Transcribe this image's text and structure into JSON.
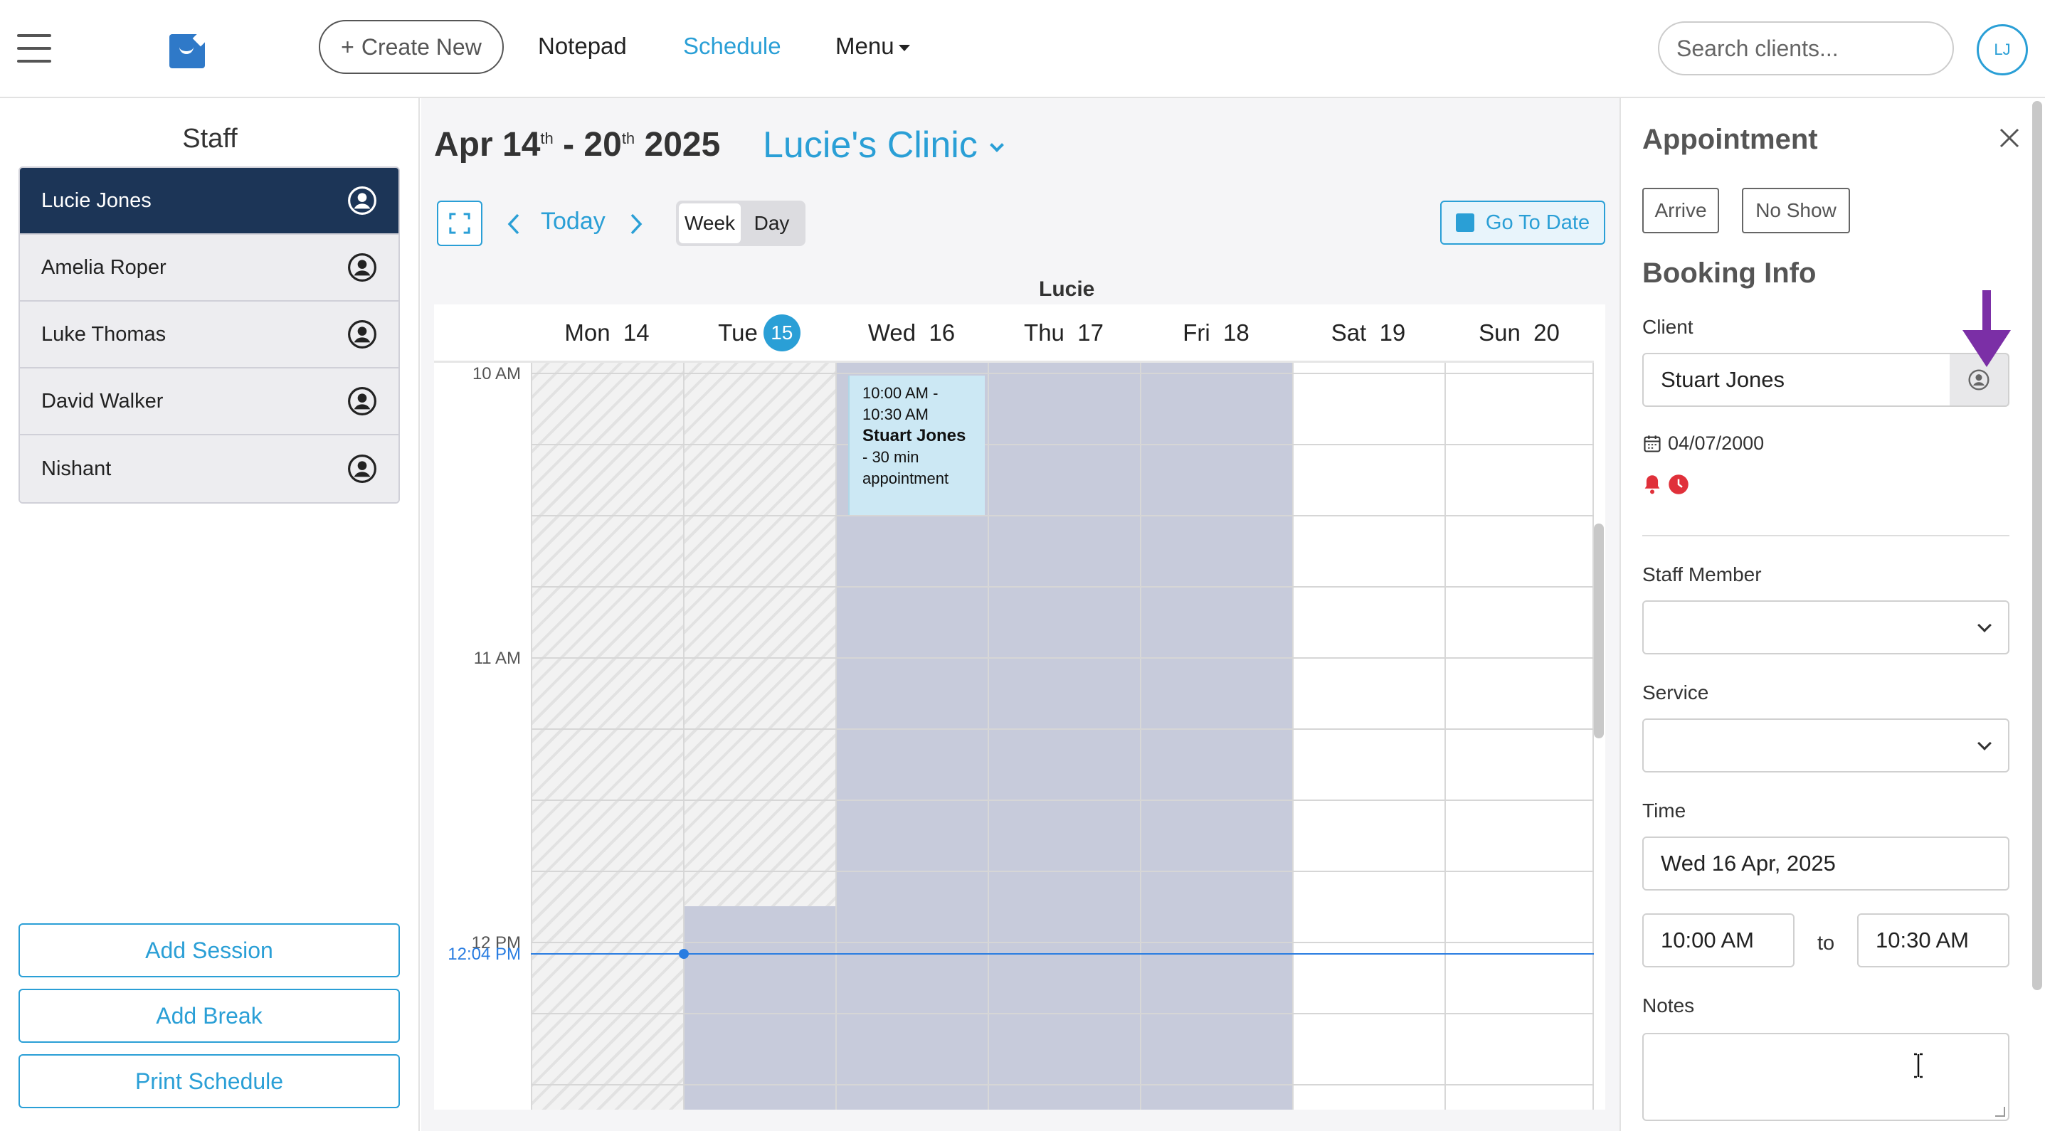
{
  "nav": {
    "create_label": "Create New",
    "notepad": "Notepad",
    "schedule": "Schedule",
    "menu": "Menu",
    "search_placeholder": "Search clients...",
    "avatar_initials": "LJ"
  },
  "staff": {
    "title": "Staff",
    "members": [
      "Lucie Jones",
      "Amelia Roper",
      "Luke Thomas",
      "David Walker",
      "Nishant"
    ],
    "active_index": 0,
    "buttons": {
      "add_session": "Add Session",
      "add_break": "Add Break",
      "print": "Print Schedule"
    }
  },
  "calendar": {
    "month": "Apr",
    "start_day": "14",
    "start_suffix": "th",
    "end_day": "20",
    "end_suffix": "th",
    "year": "2025",
    "clinic": "Lucie's Clinic",
    "today_label": "Today",
    "view_week": "Week",
    "view_day": "Day",
    "goto_label": "Go To Date",
    "staff_column": "Lucie",
    "days": [
      {
        "name": "Mon",
        "num": "14"
      },
      {
        "name": "Tue",
        "num": "15",
        "today": true
      },
      {
        "name": "Wed",
        "num": "16"
      },
      {
        "name": "Thu",
        "num": "17"
      },
      {
        "name": "Fri",
        "num": "18"
      },
      {
        "name": "Sat",
        "num": "19"
      },
      {
        "name": "Sun",
        "num": "20"
      }
    ],
    "time_labels": [
      "10 AM",
      "11 AM",
      "12 PM"
    ],
    "current_time": "12:04 PM",
    "event": {
      "time": "10:00 AM - 10:30 AM",
      "client": "Stuart Jones",
      "desc": " - 30 min appointment"
    }
  },
  "appointment": {
    "title": "Appointment",
    "arrive": "Arrive",
    "no_show": "No Show",
    "booking_title": "Booking Info",
    "client_label": "Client",
    "client_value": "Stuart Jones",
    "dob": "04/07/2000",
    "staff_label": "Staff Member",
    "service_label": "Service",
    "time_label": "Time",
    "date_value": "Wed 16 Apr, 2025",
    "start_time": "10:00 AM",
    "to_label": "to",
    "end_time": "10:30 AM",
    "notes_label": "Notes"
  },
  "colors": {
    "accent": "#2a9fd6",
    "active_staff": "#1c3557",
    "event_bg": "#cce8f4",
    "working_shade": "#c7cbdb",
    "now_line": "#2a7de1",
    "annotation_arrow": "#7b2fa6",
    "alert_red": "#e0303a"
  },
  "icons": [
    "hamburger-icon",
    "plus-icon",
    "person-circle-icon",
    "chevron-left-icon",
    "chevron-right-icon",
    "expand-icon",
    "calendar-icon",
    "close-icon",
    "bell-icon",
    "clock-icon",
    "chevron-down-icon"
  ]
}
